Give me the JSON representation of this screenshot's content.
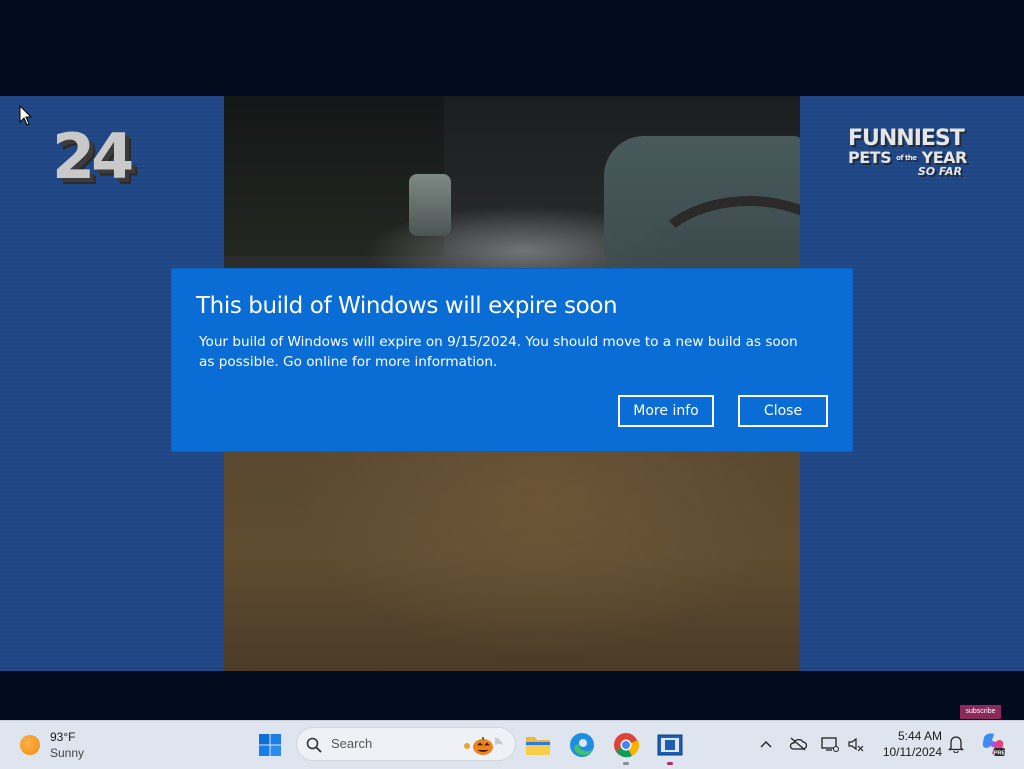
{
  "video": {
    "counter": "24",
    "logo": {
      "line1": "FUNNIEST",
      "line2_a": "PETS",
      "line2_small": "of the",
      "line2_b": "YEAR",
      "line3": "SO FAR"
    },
    "subscribe_label": "subscribe"
  },
  "dialog": {
    "title": "This build of Windows will expire soon",
    "body": "Your build of Windows will expire on 9/15/2024. You should move to a new build as soon as possible. Go online for more information.",
    "more_info_label": "More info",
    "close_label": "Close",
    "background_color": "#0a6cd5"
  },
  "taskbar": {
    "weather": {
      "temperature": "93°F",
      "condition": "Sunny",
      "icon": "sun-icon"
    },
    "search": {
      "placeholder": "Search"
    },
    "pinned": [
      {
        "name": "windows-start-icon"
      },
      {
        "name": "file-explorer-icon"
      },
      {
        "name": "edge-icon"
      },
      {
        "name": "chrome-icon"
      },
      {
        "name": "app-window-icon"
      }
    ],
    "clock": {
      "time": "5:44 AM",
      "date": "10/11/2024"
    }
  }
}
